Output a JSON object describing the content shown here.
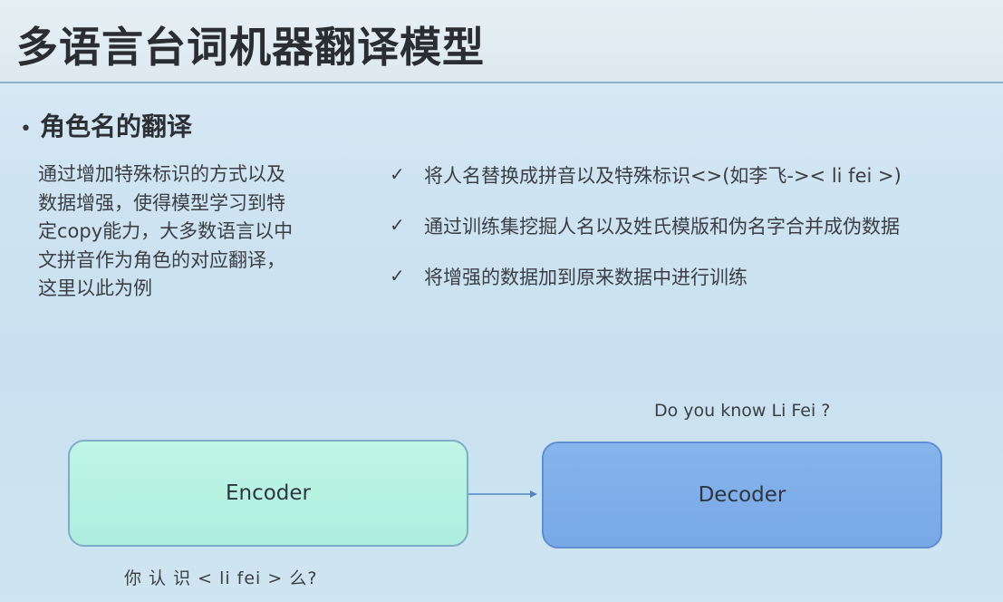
{
  "title": "多语言台词机器翻译模型",
  "section": {
    "bullet": "•",
    "heading": "角色名的翻译",
    "description_lines": [
      "通过增加特殊标识的方式以及",
      "数据增强，使得模型学习到特",
      "定copy能力，大多数语言以中",
      "文拼音作为角色的对应翻译，",
      "这里以此为例"
    ]
  },
  "checklist": {
    "icon": "check-icon",
    "icon_glyph": "✓",
    "items": [
      "将人名替换成拼音以及特殊标识<>(如李飞->< li fei >)",
      "通过训练集挖掘人名以及姓氏模版和伪名字合并成伪数据",
      "将增强的数据加到原来数据中进行训练"
    ]
  },
  "diagram": {
    "encoder_label": "Encoder",
    "decoder_label": "Decoder",
    "output_text": "Do you know Li Fei ?",
    "input_text": "你 认 识 < li fei > 么?",
    "colors": {
      "encoder_fill": "#b6f2e2",
      "decoder_fill": "#80aee9",
      "connector": "#4f86c6"
    }
  }
}
